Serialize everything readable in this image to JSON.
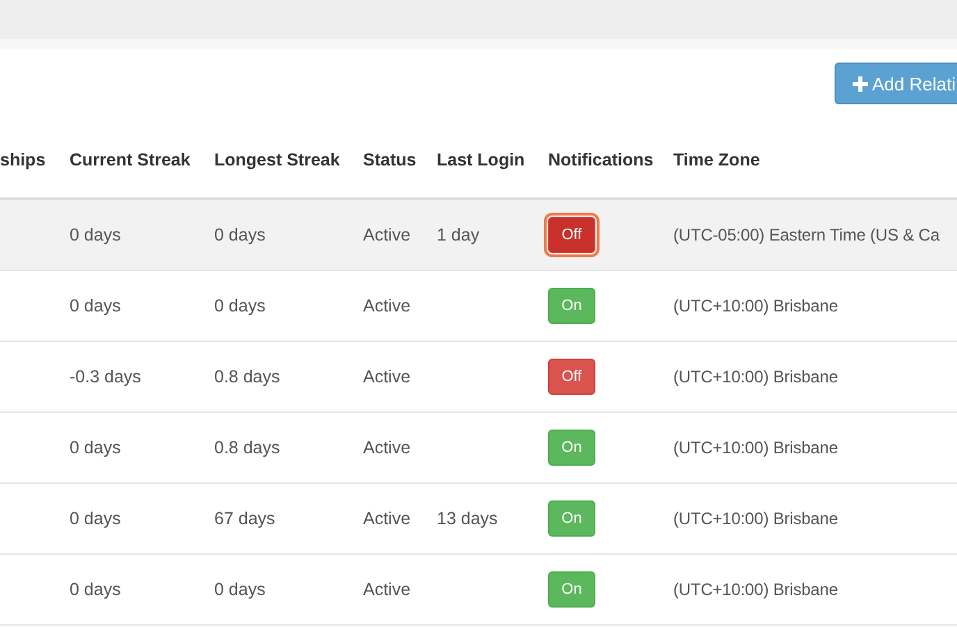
{
  "add_button": {
    "label": "Add Relati"
  },
  "table": {
    "columns": [
      "ships",
      "Current Streak",
      "Longest Streak",
      "Status",
      "Last Login",
      "Notifications",
      "Time Zone"
    ],
    "rows": [
      {
        "highlighted": true,
        "current_streak": "0 days",
        "longest_streak": "0 days",
        "status": "Active",
        "last_login": "1 day",
        "notifications": {
          "label": "Off",
          "on": false,
          "focused": true
        },
        "time_zone": "(UTC-05:00) Eastern Time (US & Ca"
      },
      {
        "highlighted": false,
        "current_streak": "0 days",
        "longest_streak": "0 days",
        "status": "Active",
        "last_login": "",
        "notifications": {
          "label": "On",
          "on": true,
          "focused": false
        },
        "time_zone": "(UTC+10:00) Brisbane"
      },
      {
        "highlighted": false,
        "current_streak": "-0.3 days",
        "longest_streak": "0.8 days",
        "status": "Active",
        "last_login": "",
        "notifications": {
          "label": "Off",
          "on": false,
          "focused": false
        },
        "time_zone": "(UTC+10:00) Brisbane"
      },
      {
        "highlighted": false,
        "current_streak": "0 days",
        "longest_streak": "0.8 days",
        "status": "Active",
        "last_login": "",
        "notifications": {
          "label": "On",
          "on": true,
          "focused": false
        },
        "time_zone": "(UTC+10:00) Brisbane"
      },
      {
        "highlighted": false,
        "current_streak": "0 days",
        "longest_streak": "67 days",
        "status": "Active",
        "last_login": "13 days",
        "notifications": {
          "label": "On",
          "on": true,
          "focused": false
        },
        "time_zone": "(UTC+10:00) Brisbane"
      },
      {
        "highlighted": false,
        "current_streak": "0 days",
        "longest_streak": "0 days",
        "status": "Active",
        "last_login": "",
        "notifications": {
          "label": "On",
          "on": true,
          "focused": false
        },
        "time_zone": "(UTC+10:00) Brisbane"
      }
    ]
  }
}
